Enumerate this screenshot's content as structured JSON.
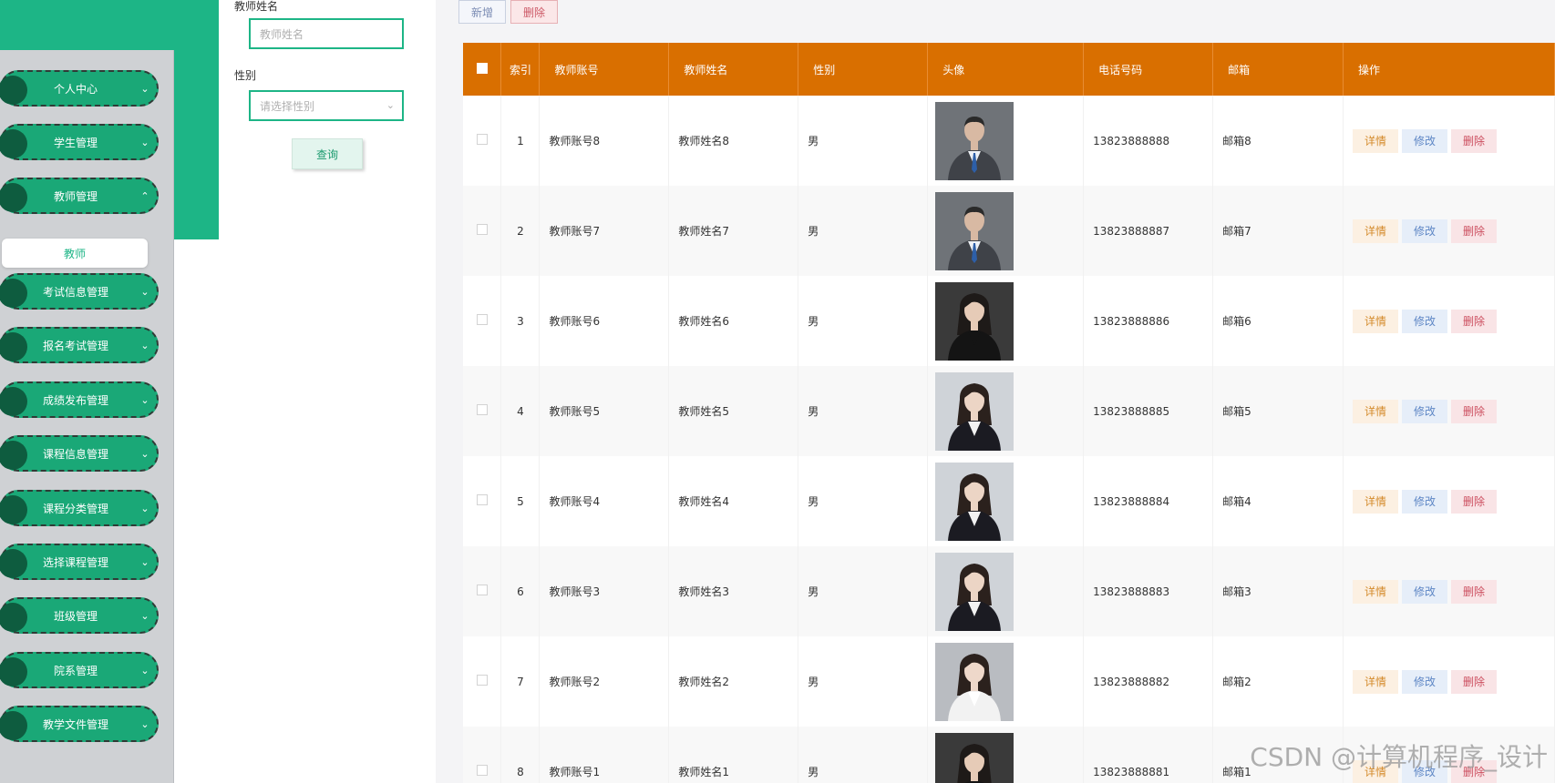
{
  "sidebar": {
    "menu": [
      {
        "label": "个人中心",
        "chevron": "⌄"
      },
      {
        "label": "学生管理",
        "chevron": "⌄"
      },
      {
        "label": "教师管理",
        "chevron": "⌃"
      },
      {
        "label": "考试信息管理",
        "chevron": "⌄"
      },
      {
        "label": "报名考试管理",
        "chevron": "⌄"
      },
      {
        "label": "成绩发布管理",
        "chevron": "⌄"
      },
      {
        "label": "课程信息管理",
        "chevron": "⌄"
      },
      {
        "label": "课程分类管理",
        "chevron": "⌄"
      },
      {
        "label": "选择课程管理",
        "chevron": "⌄"
      },
      {
        "label": "班级管理",
        "chevron": "⌄"
      },
      {
        "label": "院系管理",
        "chevron": "⌄"
      },
      {
        "label": "教学文件管理",
        "chevron": "⌄"
      }
    ],
    "sub_item": "教师"
  },
  "search": {
    "name_label": "教师姓名",
    "name_placeholder": "教师姓名",
    "gender_label": "性别",
    "gender_placeholder": "请选择性别",
    "query_button": "查询"
  },
  "toolbar": {
    "add_label": "新增",
    "delete_label": "删除"
  },
  "table": {
    "headers": {
      "index": "索引",
      "account": "教师账号",
      "name": "教师姓名",
      "gender": "性别",
      "avatar": "头像",
      "phone": "电话号码",
      "email": "邮箱",
      "actions": "操作"
    },
    "action_labels": {
      "detail": "详情",
      "edit": "修改",
      "delete": "删除"
    },
    "rows": [
      {
        "index": "1",
        "account": "教师账号8",
        "name": "教师姓名8",
        "gender": "男",
        "phone": "13823888888",
        "email": "邮箱8",
        "avatar": "male-suit"
      },
      {
        "index": "2",
        "account": "教师账号7",
        "name": "教师姓名7",
        "gender": "男",
        "phone": "13823888887",
        "email": "邮箱7",
        "avatar": "male-suit"
      },
      {
        "index": "3",
        "account": "教师账号6",
        "name": "教师姓名6",
        "gender": "男",
        "phone": "13823888886",
        "email": "邮箱6",
        "avatar": "female-black"
      },
      {
        "index": "4",
        "account": "教师账号5",
        "name": "教师姓名5",
        "gender": "男",
        "phone": "13823888885",
        "email": "邮箱5",
        "avatar": "female-suit"
      },
      {
        "index": "5",
        "account": "教师账号4",
        "name": "教师姓名4",
        "gender": "男",
        "phone": "13823888884",
        "email": "邮箱4",
        "avatar": "female-suit"
      },
      {
        "index": "6",
        "account": "教师账号3",
        "name": "教师姓名3",
        "gender": "男",
        "phone": "13823888883",
        "email": "邮箱3",
        "avatar": "female-suit"
      },
      {
        "index": "7",
        "account": "教师账号2",
        "name": "教师姓名2",
        "gender": "男",
        "phone": "13823888882",
        "email": "邮箱2",
        "avatar": "female-white"
      },
      {
        "index": "8",
        "account": "教师账号1",
        "name": "教师姓名1",
        "gender": "男",
        "phone": "13823888881",
        "email": "邮箱1",
        "avatar": "female-black"
      }
    ]
  },
  "watermark": "CSDN @计算机程序_设计",
  "colors": {
    "accent_green": "#1db586",
    "menu_green": "#1aa877",
    "header_orange": "#d96f00"
  }
}
